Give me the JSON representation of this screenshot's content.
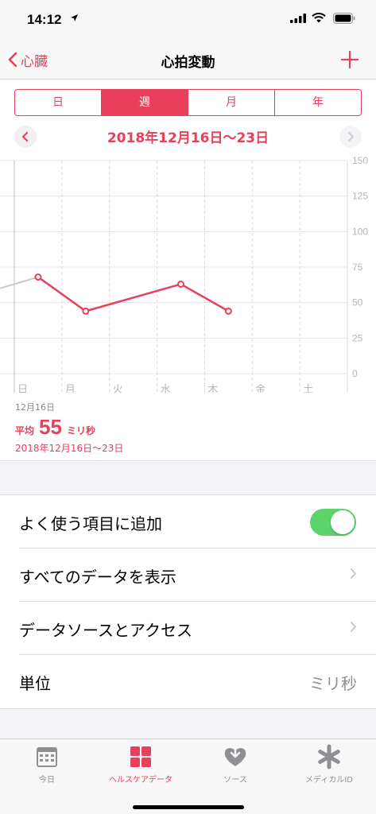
{
  "status_bar": {
    "time": "14:12"
  },
  "nav": {
    "back_label": "心臓",
    "title": "心拍変動"
  },
  "segments": [
    {
      "label": "日",
      "active": false
    },
    {
      "label": "週",
      "active": true
    },
    {
      "label": "月",
      "active": false
    },
    {
      "label": "年",
      "active": false
    }
  ],
  "range_title": "2018年12月16日〜23日",
  "colors": {
    "accent": "#e8405b",
    "toggle_on": "#5fd36b",
    "secondary_text": "#8e8e93"
  },
  "chart_data": {
    "type": "line",
    "categories": [
      "日",
      "月",
      "火",
      "水",
      "木",
      "金",
      "土"
    ],
    "x_sublabel": "12月16日",
    "series": [
      {
        "values": [
          68,
          44,
          null,
          63,
          44,
          null,
          null
        ]
      }
    ],
    "previous_value": 60,
    "y_ticks": [
      "150",
      "125",
      "100",
      "75",
      "50",
      "25",
      "0"
    ],
    "ylim": [
      0,
      150
    ],
    "title": "",
    "xlabel": "",
    "ylabel": "",
    "grid": true
  },
  "summary": {
    "avg_label": "平均",
    "avg_value": "55",
    "avg_unit": "ミリ秒",
    "range": "2018年12月16日〜23日"
  },
  "list": {
    "favorite_label": "よく使う項目に追加",
    "favorite_on": true,
    "show_all_label": "すべてのデータを表示",
    "sources_label": "データソースとアクセス",
    "unit_label": "単位",
    "unit_value": "ミリ秒"
  },
  "tabs": [
    {
      "label": "今日",
      "icon": "calendar-icon",
      "active": false
    },
    {
      "label": "ヘルスケアデータ",
      "icon": "grid-icon",
      "active": true
    },
    {
      "label": "ソース",
      "icon": "heart-download-icon",
      "active": false
    },
    {
      "label": "メディカルID",
      "icon": "asterisk-icon",
      "active": false
    }
  ]
}
